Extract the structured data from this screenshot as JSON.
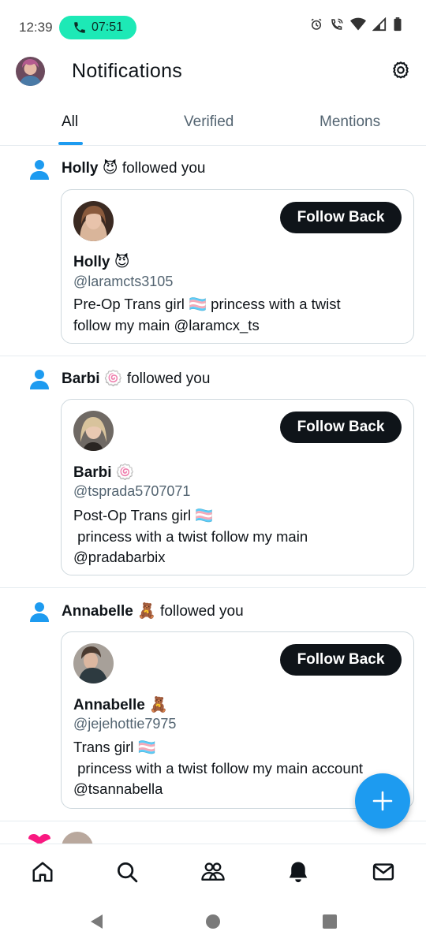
{
  "status_bar": {
    "time": "12:39",
    "call_timer": "07:51",
    "icons": [
      "alarm-icon",
      "wifi-call-icon",
      "wifi-icon",
      "signal-icon",
      "battery-icon"
    ]
  },
  "header": {
    "title": "Notifications",
    "settings_icon": "gear-icon"
  },
  "tabs": [
    {
      "label": "All",
      "active": true
    },
    {
      "label": "Verified",
      "active": false
    },
    {
      "label": "Mentions",
      "active": false
    }
  ],
  "notifications": [
    {
      "actor": "Holly",
      "emoji": "😈",
      "action": "followed you",
      "card": {
        "name": "Holly",
        "handle": "@laramcts3105",
        "bio": "Pre-Op Trans girl 🏳️‍⚧️ princess with a twist\nfollow my main @laramcx_ts",
        "button": "Follow Back"
      }
    },
    {
      "actor": "Barbi",
      "emoji": "🍥",
      "action": "followed you",
      "card": {
        "name": "Barbi",
        "handle": "@tsprada5707071",
        "bio": "Post-Op Trans girl 🏳️‍⚧️\n princess with a twist follow my main\n@pradabarbix",
        "button": "Follow Back"
      }
    },
    {
      "actor": "Annabelle",
      "emoji": "🧸",
      "action": "followed you",
      "card": {
        "name": "Annabelle",
        "handle": "@jejehottie7975",
        "bio": "Trans girl 🏳️‍⚧️\n princess with a twist follow my main account\n@tsannabella",
        "button": "Follow Back"
      }
    }
  ],
  "fab_icon": "plus-icon",
  "bottom_nav": [
    "home-icon",
    "search-icon",
    "communities-icon",
    "notifications-bell-icon",
    "messages-icon"
  ],
  "system_nav": [
    "back-icon",
    "home-circle-icon",
    "recents-icon"
  ],
  "colors": {
    "accent": "#1d9bf0",
    "call_pill": "#1de9b6",
    "button_dark": "#0f1419",
    "secondary_text": "#536471"
  }
}
